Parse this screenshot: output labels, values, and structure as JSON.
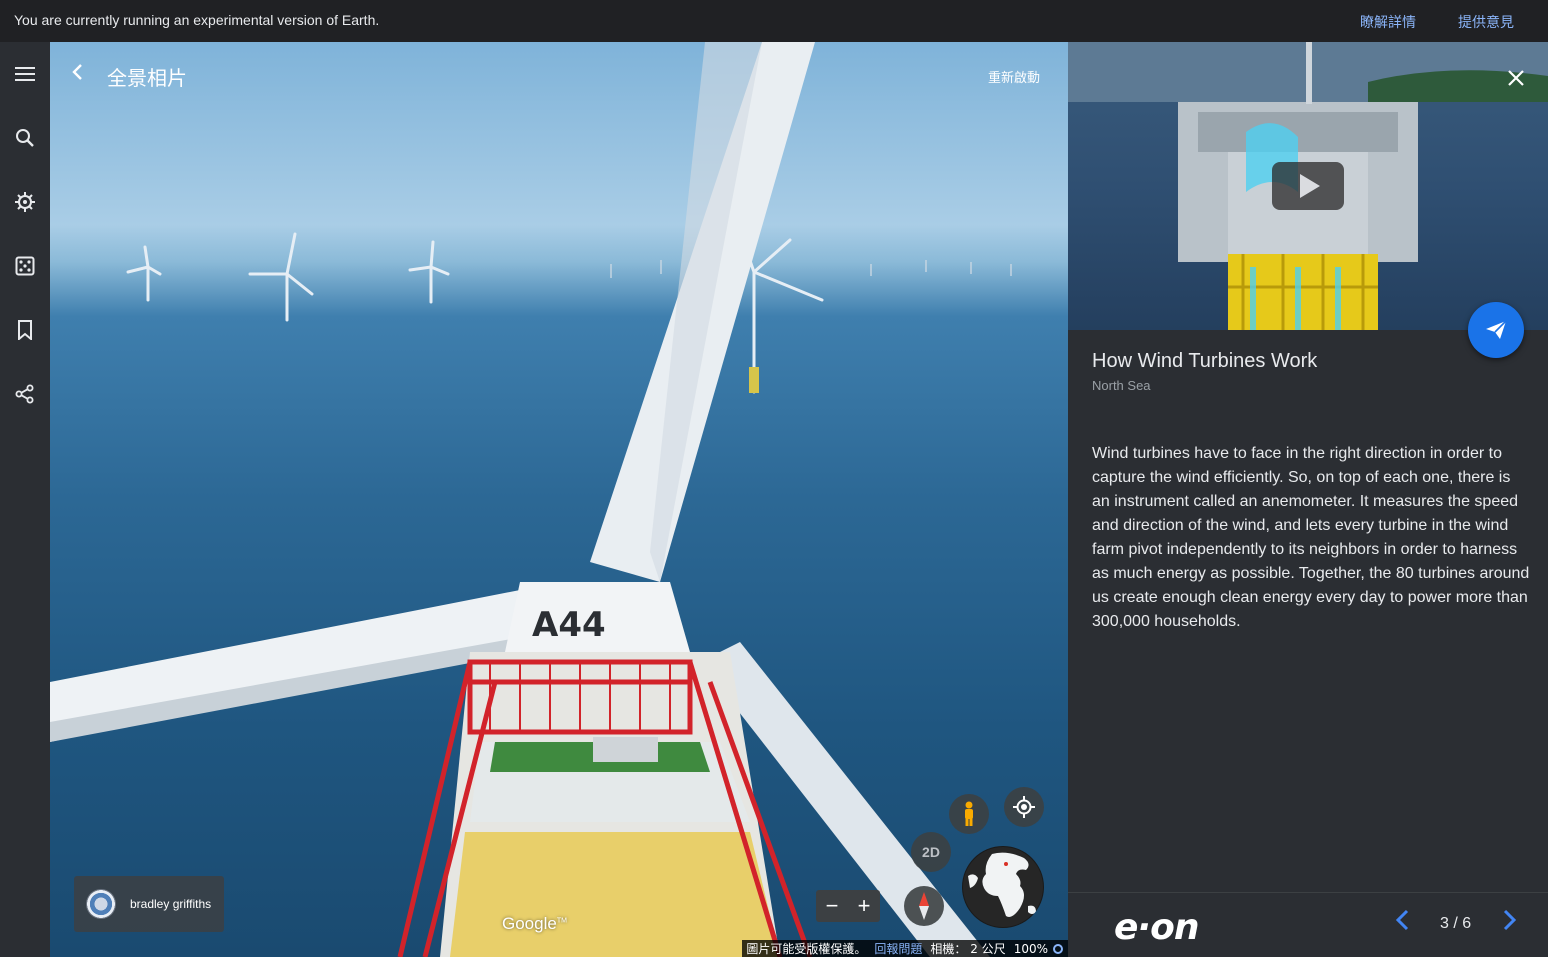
{
  "topbar": {
    "message": "You are currently running an experimental version of Earth.",
    "learn_more": "瞭解詳情",
    "feedback": "提供意見"
  },
  "sidebar": {
    "items": [
      {
        "icon": "menu-icon"
      },
      {
        "icon": "search-icon"
      },
      {
        "icon": "voyager-icon"
      },
      {
        "icon": "feeling-lucky-icon"
      },
      {
        "icon": "bookmark-icon"
      },
      {
        "icon": "share-icon"
      }
    ]
  },
  "viewer": {
    "title": "全景相片",
    "restart": "重新啟動",
    "credit_name": "bradley griffiths",
    "google_logo": "Google",
    "btn_2d": "2D",
    "zoom_out": "−",
    "zoom_in": "+",
    "turbine_label": "A44",
    "bottombar": {
      "copyright": "圖片可能受版權保護。",
      "report": "回報問題",
      "camera": "相機： 2 公尺",
      "zoom": "100%"
    }
  },
  "panel": {
    "title": "How Wind Turbines Work",
    "location": "North Sea",
    "description": "Wind turbines have to face in the right direction in order to capture the wind efficiently. So, on top of each one, there is an instrument called an anemometer. It measures the speed and direction of the wind, and lets every turbine in the wind farm pivot independently to its neighbors in order to harness as much energy as possible. Together, the 80 turbines around us create enough clean energy every day to power more than 300,000 households.",
    "brand": "e·on",
    "page": "3 / 6"
  },
  "colors": {
    "accent": "#1a73e8",
    "link": "#8ab4f8",
    "panel_bg": "#2b2e33",
    "topbar_bg": "#202124"
  }
}
